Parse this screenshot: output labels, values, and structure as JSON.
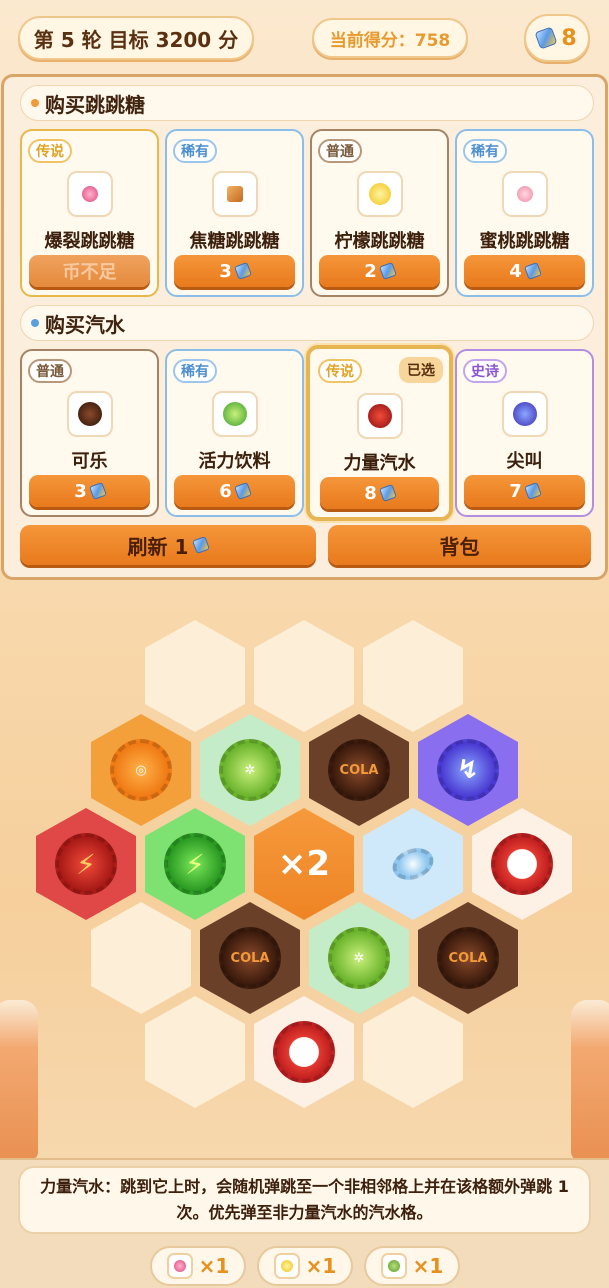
{
  "header": {
    "round_label": "第 5 轮  目标 3200 分",
    "score_label": "当前得分：758",
    "coins": "8"
  },
  "candy_section": {
    "title": "购买跳跳糖",
    "items": [
      {
        "rarity": "传说",
        "name": "爆裂跳跳糖",
        "price": "币不足",
        "icon": "berry-candy-icon"
      },
      {
        "rarity": "稀有",
        "name": "焦糖跳跳糖",
        "price": "3",
        "icon": "caramel-candy-icon"
      },
      {
        "rarity": "普通",
        "name": "柠檬跳跳糖",
        "price": "2",
        "icon": "lemon-candy-icon"
      },
      {
        "rarity": "稀有",
        "name": "蜜桃跳跳糖",
        "price": "4",
        "icon": "peach-candy-icon"
      }
    ]
  },
  "soda_section": {
    "title": "购买汽水",
    "items": [
      {
        "rarity": "普通",
        "name": "可乐",
        "price": "3",
        "icon": "cola-cap-icon"
      },
      {
        "rarity": "稀有",
        "name": "活力饮料",
        "price": "6",
        "icon": "lime-cap-icon"
      },
      {
        "rarity": "传说",
        "name": "力量汽水",
        "price": "8",
        "icon": "lightning-cap-icon",
        "selected": "已选"
      },
      {
        "rarity": "史诗",
        "name": "尖叫",
        "price": "7",
        "icon": "scream-cap-icon"
      }
    ]
  },
  "actions": {
    "refresh_label": "刷新 1",
    "bag_label": "背包"
  },
  "board": {
    "multiplier_label": "×2",
    "cola_label": "COLA"
  },
  "description": "力量汽水：跳到它上时，会随机弹跳至一个非相邻格上并在该格额外弹跳 1 次。优先弹至非力量汽水的汽水格。",
  "inventory": [
    {
      "icon": "berry-candy-icon",
      "count": "×1"
    },
    {
      "icon": "lemon-candy-icon",
      "count": "×1"
    },
    {
      "icon": "herb-candy-icon",
      "count": "×1"
    }
  ],
  "colors": {
    "accent": "#e87a1c",
    "legend": "#e8b84a",
    "rare": "#8cbde8",
    "common": "#a58466",
    "epic": "#b28ee0"
  }
}
